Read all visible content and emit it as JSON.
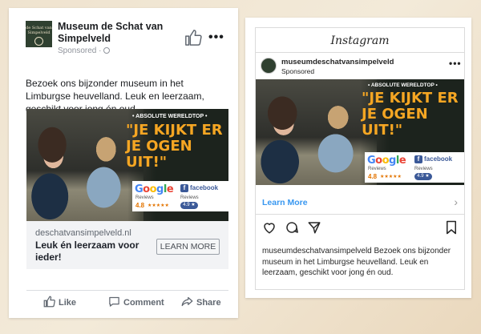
{
  "facebook": {
    "page_name": "Museum de Schat van Simpelveld",
    "logo_text": "de Schat van Simpelveld",
    "sponsored": "Sponsored",
    "post_text": "Bezoek ons bijzonder museum in het Limburgse heuvelland. Leuk en leerzaam, geschikt voor jong én oud.",
    "link_domain": "deschatvansimpelveld.nl",
    "link_title": "Leuk én leerzaam voor ieder!",
    "cta": "LEARN MORE",
    "actions": {
      "like": "Like",
      "comment": "Comment",
      "share": "Share"
    }
  },
  "ad_creative": {
    "tagline": "• ABSOLUTE WERELDTOP •",
    "headline_1": "\"JE KIJKT ER",
    "headline_2": "JE OGEN",
    "headline_3": "UIT!\"",
    "google": {
      "logo": "Google",
      "label": "Reviews",
      "score": "4.8",
      "stars": "★★★★★"
    },
    "fb_review": {
      "logo": "facebook",
      "label": "Reviews",
      "score": "4.9 ★"
    }
  },
  "instagram": {
    "brand": "Instagram",
    "username": "museumdeschatvansimpelveld",
    "sponsored": "Sponsored",
    "learn_more": "Learn More",
    "caption_user": "museumdeschatvansimpelveld",
    "caption_text": " Bezoek ons bijzonder museum in het Limburgse heuvelland. Leuk en leerzaam, geschikt voor jong én oud."
  },
  "colors": {
    "accent_orange": "#f5a623",
    "facebook_blue": "#3b5998",
    "instagram_link": "#3897f0"
  }
}
